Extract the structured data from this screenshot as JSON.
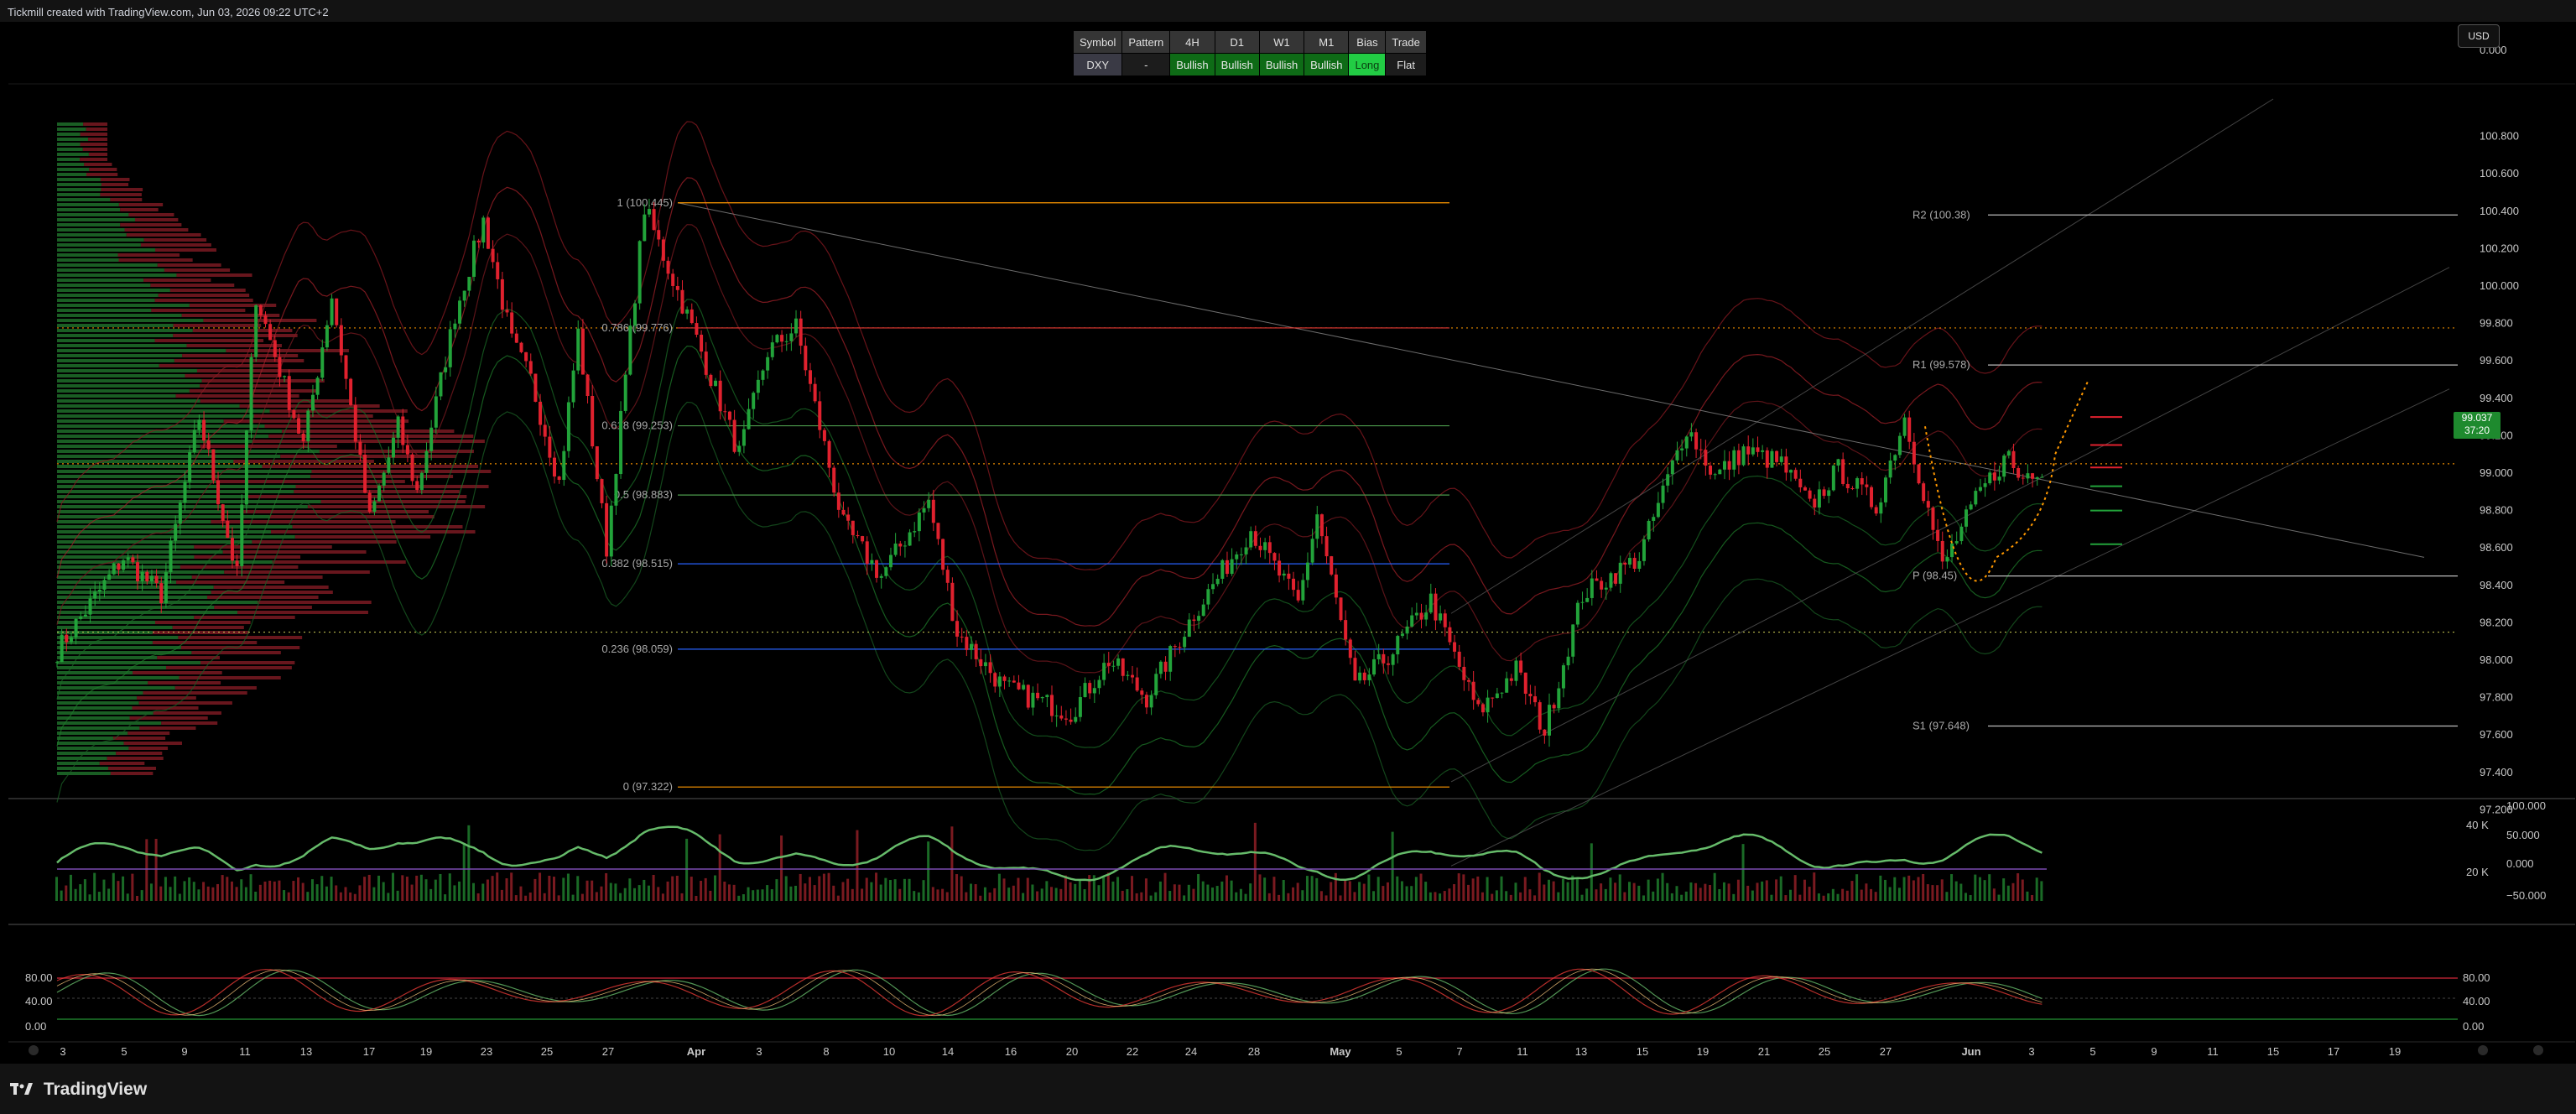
{
  "header": {
    "credit": "Tickmill created with TradingView.com, Jun 03, 2026 09:22 UTC+2",
    "currency": "USD"
  },
  "signal_table": {
    "headers": [
      "Symbol",
      "Pattern",
      "4H",
      "D1",
      "W1",
      "M1",
      "Bias",
      "Trade"
    ],
    "row": [
      {
        "text": "DXY",
        "kind": "sym"
      },
      {
        "text": "-",
        "kind": "neu"
      },
      {
        "text": "Bullish",
        "kind": "bull"
      },
      {
        "text": "Bullish",
        "kind": "bull"
      },
      {
        "text": "Bullish",
        "kind": "bull"
      },
      {
        "text": "Bullish",
        "kind": "bull"
      },
      {
        "text": "Long",
        "kind": "long"
      },
      {
        "text": "Flat",
        "kind": "neu"
      }
    ]
  },
  "price_badge": {
    "price": "99.037",
    "countdown": "37:20"
  },
  "colors": {
    "bull": "#22a33a",
    "bear": "#e0212e",
    "fib": "#ff9800",
    "bg": "#000000"
  },
  "chart_data": {
    "type": "candlestick",
    "symbol": "DXY",
    "ylim": [
      97.0,
      101.0
    ],
    "y_ticks": [
      "100.800",
      "100.600",
      "100.400",
      "100.200",
      "100.000",
      "99.800",
      "99.600",
      "99.400",
      "99.200",
      "99.000",
      "98.800",
      "98.600",
      "98.400",
      "98.200",
      "98.000",
      "97.800",
      "97.600",
      "97.400",
      "97.200",
      "0.000"
    ],
    "x_ticks": [
      "3",
      "5",
      "9",
      "11",
      "13",
      "17",
      "19",
      "23",
      "25",
      "27",
      "Apr",
      "3",
      "8",
      "10",
      "14",
      "16",
      "20",
      "22",
      "24",
      "28",
      "May",
      "5",
      "7",
      "11",
      "13",
      "15",
      "19",
      "21",
      "25",
      "27",
      "Jun",
      "3",
      "5",
      "9",
      "11",
      "15",
      "17",
      "19"
    ],
    "last_price": 99.037,
    "path": [
      [
        0,
        98.05
      ],
      [
        14,
        98.55
      ],
      [
        22,
        98.35
      ],
      [
        30,
        99.3
      ],
      [
        38,
        98.45
      ],
      [
        42,
        99.95
      ],
      [
        52,
        99.15
      ],
      [
        58,
        99.95
      ],
      [
        66,
        98.75
      ],
      [
        72,
        99.25
      ],
      [
        76,
        98.9
      ],
      [
        84,
        99.85
      ],
      [
        90,
        100.35
      ],
      [
        96,
        99.7
      ],
      [
        100,
        99.5
      ],
      [
        106,
        98.95
      ],
      [
        110,
        99.75
      ],
      [
        116,
        98.6
      ],
      [
        124,
        100.42
      ],
      [
        136,
        99.65
      ],
      [
        144,
        99.1
      ],
      [
        150,
        99.65
      ],
      [
        156,
        99.78
      ],
      [
        166,
        98.72
      ],
      [
        174,
        98.45
      ],
      [
        184,
        98.85
      ],
      [
        190,
        98.15
      ],
      [
        200,
        97.85
      ],
      [
        214,
        97.72
      ],
      [
        222,
        98.0
      ],
      [
        230,
        97.8
      ],
      [
        240,
        98.25
      ],
      [
        252,
        98.7
      ],
      [
        262,
        98.3
      ],
      [
        266,
        98.78
      ],
      [
        274,
        97.85
      ],
      [
        282,
        98.05
      ],
      [
        290,
        98.32
      ],
      [
        300,
        97.72
      ],
      [
        308,
        97.95
      ],
      [
        314,
        97.62
      ],
      [
        322,
        98.35
      ],
      [
        334,
        98.55
      ],
      [
        344,
        99.25
      ],
      [
        350,
        98.98
      ],
      [
        356,
        99.12
      ],
      [
        364,
        99.05
      ],
      [
        370,
        98.82
      ],
      [
        376,
        99.02
      ],
      [
        384,
        98.82
      ],
      [
        390,
        99.3
      ],
      [
        398,
        98.5
      ],
      [
        406,
        98.9
      ],
      [
        412,
        99.1
      ],
      [
        414,
        98.97
      ],
      [
        418,
        99.03
      ]
    ],
    "fib_levels": [
      {
        "label": "1 (100.445)",
        "value": 100.445
      },
      {
        "label": "0.786 (99.776)",
        "value": 99.776
      },
      {
        "label": "0.618 (99.253)",
        "value": 99.253
      },
      {
        "label": "0.5 (98.883)",
        "value": 98.883
      },
      {
        "label": "0.382 (98.515)",
        "value": 98.515
      },
      {
        "label": "0.236 (98.059)",
        "value": 98.059
      },
      {
        "label": "0 (97.322)",
        "value": 97.322
      }
    ],
    "pivots": [
      {
        "label": "R2 (100.38)",
        "value": 100.38
      },
      {
        "label": "R1 (99.578)",
        "value": 99.578
      },
      {
        "label": "P (98.45)",
        "value": 98.45
      },
      {
        "label": "S1 (97.648)",
        "value": 97.648
      }
    ],
    "volume_panel": {
      "y_ticks": [
        "40 K",
        "20 K"
      ],
      "osc_ticks": [
        "100.000",
        "50.000",
        "0.000",
        "−50.000"
      ]
    },
    "stoch_panel": {
      "y_ticks": [
        "80.00",
        "40.00",
        "0.00"
      ],
      "levels": [
        80,
        20
      ]
    }
  },
  "footer": {
    "brand": "TradingView"
  }
}
